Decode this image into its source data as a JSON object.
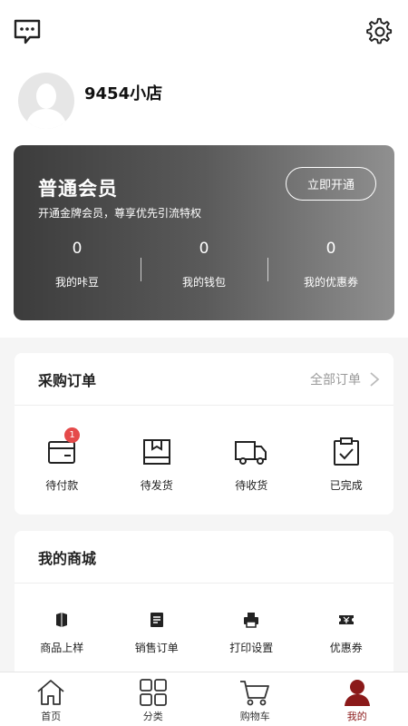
{
  "header": {
    "message_icon": "message-dots-icon",
    "settings_icon": "gear-icon"
  },
  "profile": {
    "avatar_icon": "avatar-placeholder-icon",
    "shop_name": "9454小店"
  },
  "membership": {
    "title": "普通会员",
    "subtitle": "开通金牌会员，尊享优先引流特权",
    "open_button": "立即开通",
    "stats": [
      {
        "value": "0",
        "label": "我的咔豆"
      },
      {
        "value": "0",
        "label": "我的钱包"
      },
      {
        "value": "0",
        "label": "我的优惠券"
      }
    ]
  },
  "purchase_orders": {
    "title": "采购订单",
    "all_label": "全部订单",
    "items": [
      {
        "label": "待付款",
        "icon": "wallet-icon",
        "badge": "1"
      },
      {
        "label": "待发货",
        "icon": "box-icon"
      },
      {
        "label": "待收货",
        "icon": "truck-icon"
      },
      {
        "label": "已完成",
        "icon": "clipboard-check-icon"
      }
    ]
  },
  "my_mall": {
    "title": "我的商城",
    "items": [
      {
        "label": "商品上样",
        "icon": "product-icon"
      },
      {
        "label": "销售订单",
        "icon": "order-list-icon"
      },
      {
        "label": "打印设置",
        "icon": "printer-icon"
      },
      {
        "label": "优惠券",
        "icon": "coupon-icon"
      }
    ]
  },
  "bottom_nav": {
    "items": [
      {
        "label": "首页",
        "icon": "home-icon"
      },
      {
        "label": "分类",
        "icon": "grid-icon"
      },
      {
        "label": "购物车",
        "icon": "cart-icon"
      },
      {
        "label": "我的",
        "icon": "user-icon",
        "active": true
      }
    ]
  },
  "colors": {
    "accent": "#8b1a1a",
    "badge": "#e54a4a",
    "card_dark": "#3c3c3c",
    "card_light": "#909090"
  }
}
